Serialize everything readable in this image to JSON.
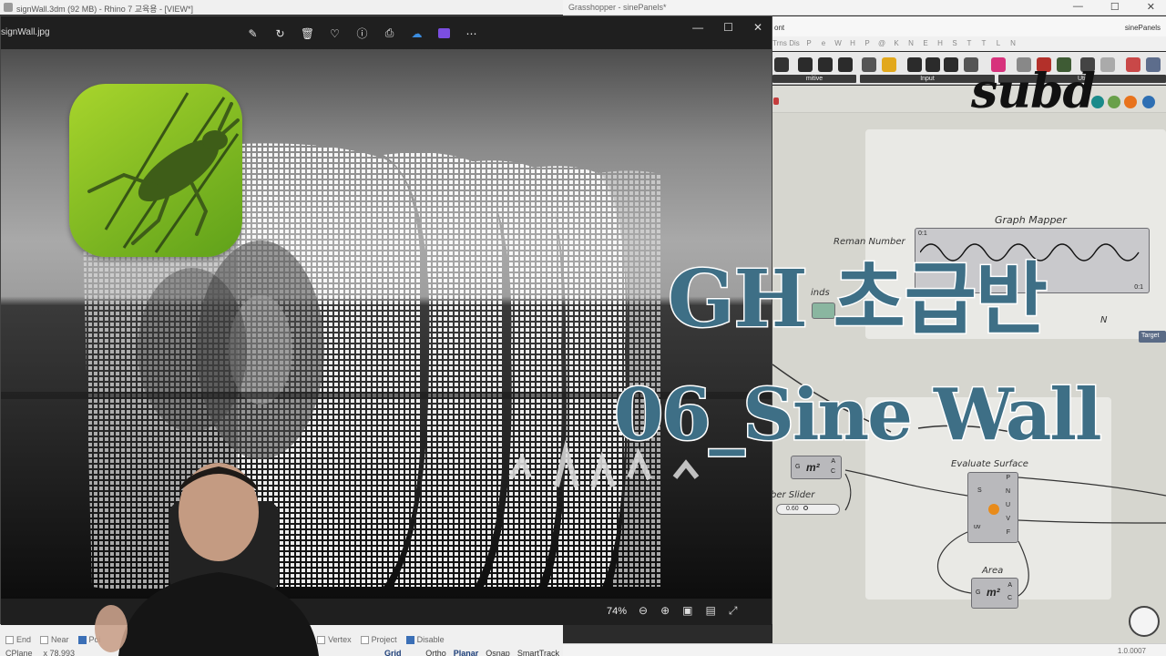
{
  "rhino": {
    "title": "signWall.3dm (92 MB) - Rhino 7 교육용 - [VIEW*]",
    "osnaps": [
      {
        "label": "End",
        "on": false
      },
      {
        "label": "Near",
        "on": false
      },
      {
        "label": "Poi",
        "on": true
      },
      {
        "label": "ot",
        "on": false
      },
      {
        "label": "Vertex",
        "on": false
      },
      {
        "label": "Project",
        "on": false
      },
      {
        "label": "Disable",
        "on": true
      }
    ],
    "status": {
      "cplane": "CPlane",
      "x": "x 78.993"
    },
    "snap_buttons": [
      "Grid Snap",
      "Ortho",
      "Planar",
      "Osnap",
      "SmartTrack"
    ]
  },
  "viewer": {
    "filename": "signWall.jpg",
    "tools": [
      "edit-icon",
      "rotate-icon",
      "delete-icon",
      "favorite-icon",
      "info-icon",
      "print-icon",
      "onedrive-icon",
      "clipchamp-icon",
      "more-icon"
    ],
    "zoom": "74%"
  },
  "grasshopper": {
    "title": "Grasshopper - sinePanels*",
    "menu_left": "ont",
    "doc_name": "sinePanels",
    "tabs": [
      "Trns",
      "Dis",
      "P",
      "e",
      "W",
      "H",
      "P",
      "@",
      "K",
      "N",
      "E",
      "H",
      "S",
      "T",
      "T",
      "L",
      "N"
    ],
    "toolbar_groups": [
      "mitive",
      "Input",
      "Util"
    ],
    "nodes": {
      "graph_mapper": "Graph Mapper",
      "graph_mapper_in": "0:1",
      "graph_mapper_out": "0:1",
      "remap": "Reman Number",
      "bounds": "inds",
      "evaluate_surface": "Evaluate Surface",
      "evaluate_inputs": [
        "S",
        "uv"
      ],
      "evaluate_outputs": [
        "P",
        "N",
        "U",
        "V",
        "F"
      ],
      "area": "Area",
      "area_in": "G",
      "area_outputs": [
        "A",
        "C"
      ],
      "area2_outputs": [
        "A",
        "C"
      ],
      "slider": "ber Slider",
      "slider_value": "0.60",
      "target": "Target",
      "n_label": "N"
    },
    "version": "1.0.0007"
  },
  "overlay": {
    "brand": "subd",
    "title_line1": "GH 초급반",
    "title_line2": "06_Sine Wall"
  },
  "colors": {
    "title_blue": "#3e6f86",
    "logo_green": "#7dbb22"
  }
}
